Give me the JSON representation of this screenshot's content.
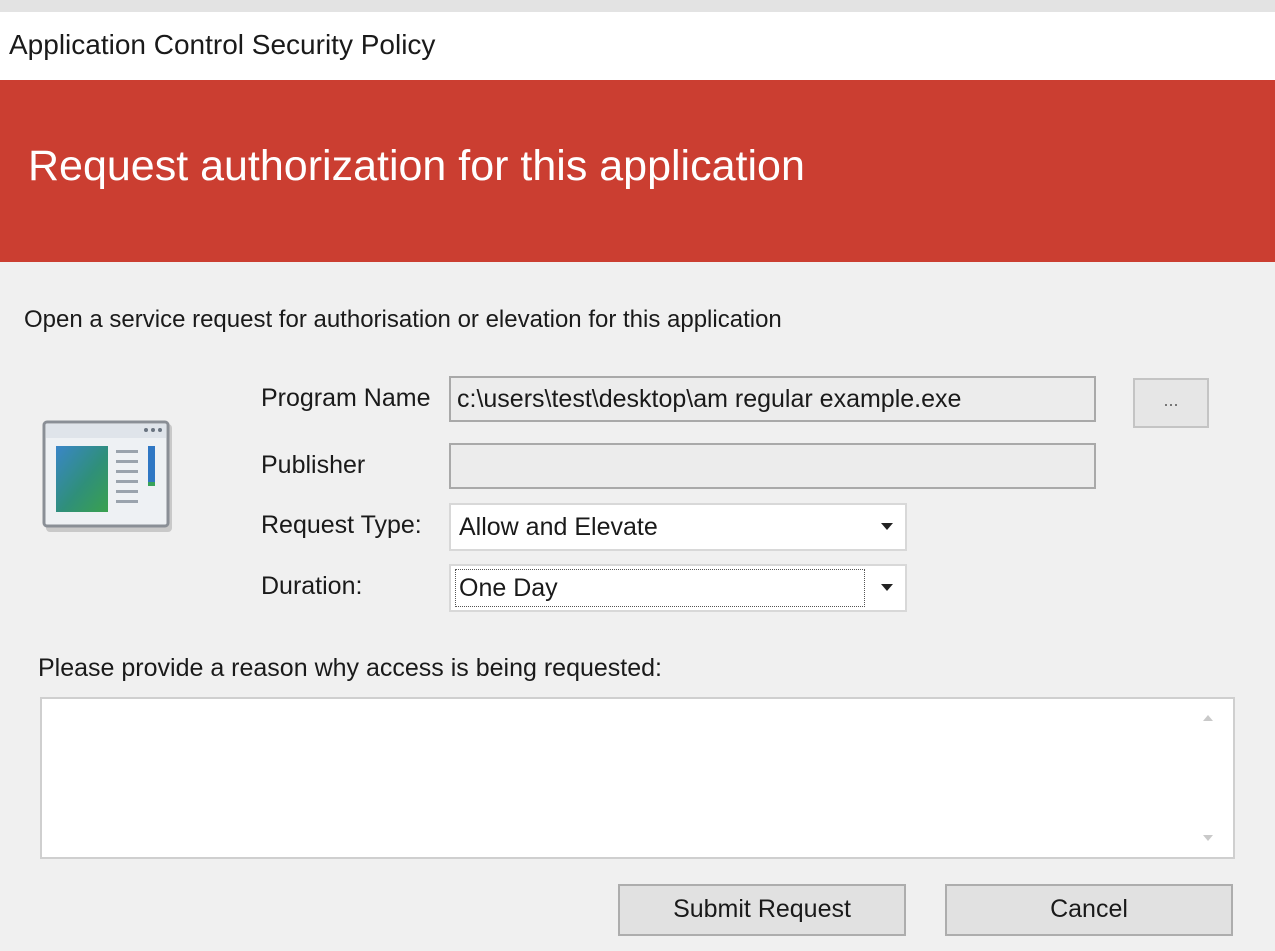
{
  "window": {
    "title": "Application Control Security Policy"
  },
  "banner": {
    "title": "Request authorization for this application",
    "color": "#cb3e31"
  },
  "intro_text": "Open a service request for authorisation or elevation for this application",
  "form": {
    "program_name": {
      "label": "Program Name",
      "value": "c:\\users\\test\\desktop\\am regular example.exe"
    },
    "browse_button": {
      "label": "..."
    },
    "publisher": {
      "label": "Publisher",
      "value": ""
    },
    "request_type": {
      "label": "Request Type:",
      "selected": "Allow and Elevate"
    },
    "duration": {
      "label": "Duration:",
      "selected": "One Day"
    }
  },
  "reason": {
    "label": "Please provide a reason why access is being requested:",
    "value": ""
  },
  "buttons": {
    "submit": "Submit Request",
    "cancel": "Cancel"
  },
  "icons": {
    "app_icon": "application-window-icon",
    "dropdown": "chevron-down-icon"
  }
}
